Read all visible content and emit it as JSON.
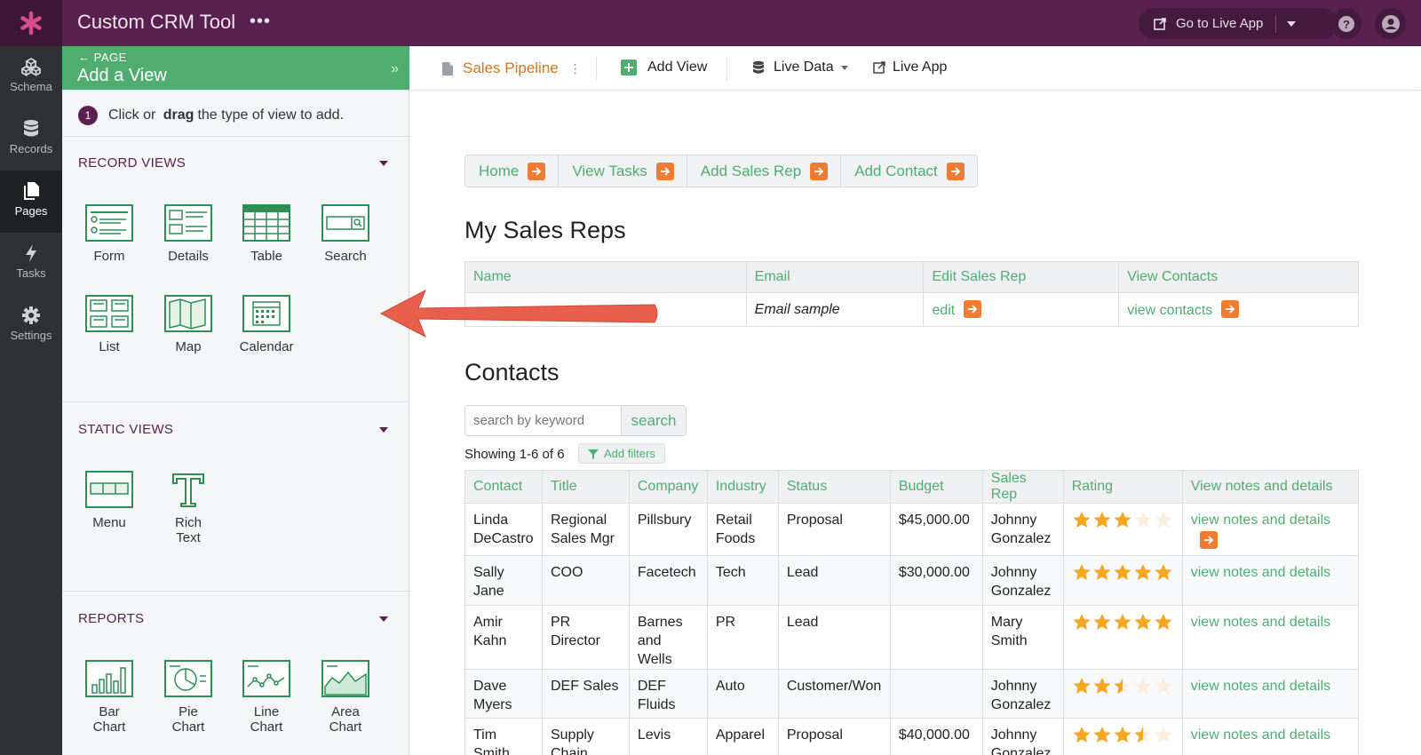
{
  "header": {
    "app_title": "Custom CRM Tool",
    "more": "•••",
    "go_live": "Go to Live App"
  },
  "rail": [
    {
      "label": "Schema",
      "icon": "cubes-icon"
    },
    {
      "label": "Records",
      "icon": "database-icon"
    },
    {
      "label": "Pages",
      "icon": "pages-icon"
    },
    {
      "label": "Tasks",
      "icon": "bolt-icon"
    },
    {
      "label": "Settings",
      "icon": "gear-icon"
    }
  ],
  "panel": {
    "crumb": "PAGE",
    "title": "Add a View",
    "step_num": "1",
    "step_pre": "Click or ",
    "step_bold": "drag",
    "step_post": " the type of view to add.",
    "record_views_title": "RECORD VIEWS",
    "record_views": [
      "Form",
      "Details",
      "Table",
      "Search",
      "List",
      "Map",
      "Calendar"
    ],
    "static_views_title": "STATIC VIEWS",
    "static_views": [
      "Menu",
      "Rich Text"
    ],
    "reports_title": "REPORTS",
    "reports": [
      "Bar Chart",
      "Pie Chart",
      "Line Chart",
      "Area Chart"
    ]
  },
  "toolbar": {
    "page_name": "Sales Pipeline",
    "add_view": "Add View",
    "live_data": "Live Data",
    "live_app": "Live App"
  },
  "menu": [
    "Home",
    "View Tasks",
    "Add Sales Rep",
    "Add Contact"
  ],
  "reps": {
    "heading": "My Sales Reps",
    "columns": [
      "Name",
      "Email",
      "Edit Sales Rep",
      "View Contacts"
    ],
    "row": {
      "name": "",
      "email": "Email sample",
      "edit": "edit",
      "view": "view contacts"
    }
  },
  "contacts": {
    "heading": "Contacts",
    "search_placeholder": "search by keyword",
    "search_button": "search",
    "showing": "Showing 1-6 of 6",
    "add_filters": "Add filters",
    "columns": [
      "Contact",
      "Title",
      "Company",
      "Industry",
      "Status",
      "Budget",
      "Sales Rep",
      "Rating",
      "View notes and details"
    ],
    "rows": [
      {
        "contact": "Linda DeCastro",
        "title": "Regional Sales Mgr",
        "company": "Pillsbury",
        "industry": "Retail Foods",
        "status": "Proposal",
        "budget": "$45,000.00",
        "rep": "Johnny Gonzalez",
        "rating": 3,
        "link": "view notes and details"
      },
      {
        "contact": "Sally Jane",
        "title": "COO",
        "company": "Facetech",
        "industry": "Tech",
        "status": "Lead",
        "budget": "$30,000.00",
        "rep": "Johnny Gonzalez",
        "rating": 5,
        "link": "view notes and details"
      },
      {
        "contact": "Amir Kahn",
        "title": "PR Director",
        "company": "Barnes and Wells",
        "industry": "PR",
        "status": "Lead",
        "budget": "",
        "rep": "Mary Smith",
        "rating": 5,
        "link": "view notes and details"
      },
      {
        "contact": "Dave Myers",
        "title": "DEF Sales",
        "company": "DEF Fluids",
        "industry": "Auto",
        "status": "Customer/Won",
        "budget": "",
        "rep": "Johnny Gonzalez",
        "rating": 2.5,
        "link": "view notes and details"
      },
      {
        "contact": "Tim Smith",
        "title": "Supply Chain",
        "company": "Levis",
        "industry": "Apparel",
        "status": "Proposal",
        "budget": "$40,000.00",
        "rep": "Johnny Gonzalez",
        "rating": 3.5,
        "link": "view notes and details"
      }
    ]
  },
  "colors": {
    "brand": "#5a2150",
    "green": "#4fae6f",
    "orange": "#f07c33",
    "star": "#f5a623",
    "arrow": "#e8604c"
  }
}
